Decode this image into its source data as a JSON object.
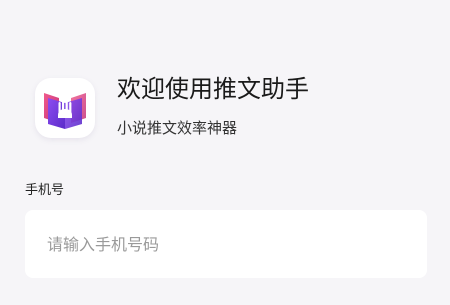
{
  "brand": {
    "logo_icon": "open-book-hand-icon",
    "accent_purple": "#7b3fe4",
    "accent_pink": "#e0467a",
    "title": "欢迎使用推文助手",
    "slogan": "小说推文效率神器"
  },
  "form": {
    "phone_label": "手机号",
    "phone_placeholder": "请输入手机号码",
    "phone_value": ""
  }
}
